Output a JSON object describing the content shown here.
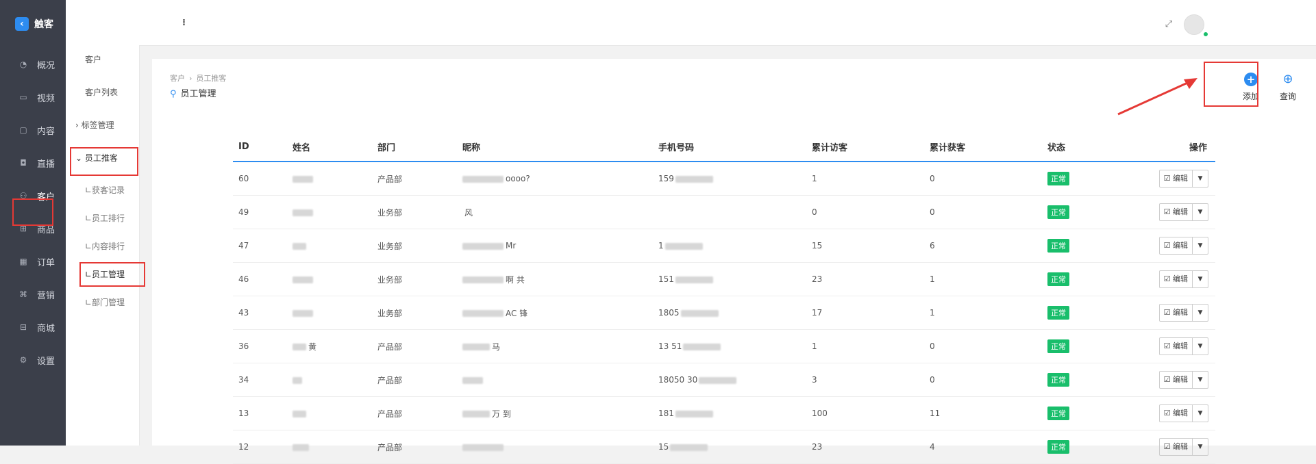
{
  "brand": {
    "name": "触客"
  },
  "nav": [
    {
      "label": "概况",
      "icon": "gauge-icon",
      "glyph": "◔"
    },
    {
      "label": "视频",
      "icon": "video-icon",
      "glyph": "▭"
    },
    {
      "label": "内容",
      "icon": "monitor-icon",
      "glyph": "▢"
    },
    {
      "label": "直播",
      "icon": "camera-icon",
      "glyph": "◘"
    },
    {
      "label": "客户",
      "icon": "user-icon",
      "glyph": "⚇"
    },
    {
      "label": "商品",
      "icon": "grid-icon",
      "glyph": "⊞"
    },
    {
      "label": "订单",
      "icon": "calendar-icon",
      "glyph": "▦"
    },
    {
      "label": "营销",
      "icon": "tag-icon",
      "glyph": "⌘"
    },
    {
      "label": "商城",
      "icon": "shop-icon",
      "glyph": "⊟"
    },
    {
      "label": "设置",
      "icon": "gear-icon",
      "glyph": "⚙"
    }
  ],
  "subnav": {
    "header": "客户",
    "items": [
      "客户列表",
      "› 标签管理",
      "⌄ 员工推客",
      "∟获客记录",
      "∟员工排行",
      "∟内容排行",
      "∟员工管理",
      "∟部门管理"
    ]
  },
  "breadcrumb": {
    "root": "客户",
    "sep": "›",
    "current": "员工推客"
  },
  "page_title": "员工管理",
  "toolbar": {
    "add_label": "添加",
    "query_label": "查询"
  },
  "table": {
    "headers": [
      "ID",
      "姓名",
      "部门",
      "昵称",
      "手机号码",
      "累计访客",
      "累计获客",
      "状态",
      "操作"
    ],
    "rows": [
      {
        "id": "60",
        "name": "",
        "dept": "产品部",
        "nick": "oooo?",
        "phone": "159",
        "visitors": "1",
        "customers": "0",
        "status": "正常"
      },
      {
        "id": "49",
        "name": "",
        "dept": "业务部",
        "nick": "风",
        "phone": "",
        "visitors": "0",
        "customers": "0",
        "status": "正常"
      },
      {
        "id": "47",
        "name": "",
        "dept": "业务部",
        "nick": "Mr",
        "phone": "1",
        "visitors": "15",
        "customers": "6",
        "status": "正常"
      },
      {
        "id": "46",
        "name": "",
        "dept": "业务部",
        "nick": "啊 共",
        "phone": "151",
        "visitors": "23",
        "customers": "1",
        "status": "正常"
      },
      {
        "id": "43",
        "name": "",
        "dept": "业务部",
        "nick": "AC 锋",
        "phone": "1805",
        "visitors": "17",
        "customers": "1",
        "status": "正常"
      },
      {
        "id": "36",
        "name": "黄",
        "dept": "产品部",
        "nick": "马",
        "phone": "13 51",
        "visitors": "1",
        "customers": "0",
        "status": "正常"
      },
      {
        "id": "34",
        "name": "",
        "dept": "产品部",
        "nick": "",
        "phone": "18050 30",
        "visitors": "3",
        "customers": "0",
        "status": "正常"
      },
      {
        "id": "13",
        "name": "",
        "dept": "产品部",
        "nick": "万 到",
        "phone": "181",
        "visitors": "100",
        "customers": "11",
        "status": "正常"
      },
      {
        "id": "12",
        "name": "",
        "dept": "产品部",
        "nick": "",
        "phone": "15",
        "visitors": "23",
        "customers": "4",
        "status": "正常"
      }
    ],
    "edit_label": "☑ 编辑",
    "dropdown_glyph": "▼"
  },
  "colors": {
    "accent": "#2d8cf0",
    "success": "#19be6b",
    "nav_bg": "#3b3f4a",
    "highlight_box": "#e53935"
  }
}
